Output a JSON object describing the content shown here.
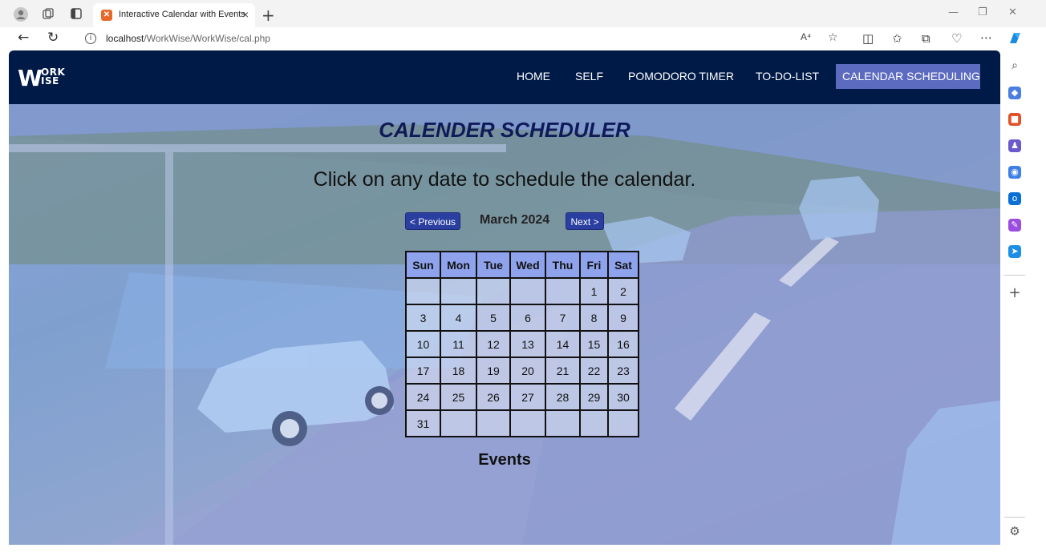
{
  "browser": {
    "tab_title": "Interactive Calendar with Events",
    "url_host": "localhost",
    "url_path": "/WorkWise/WorkWise/cal.php",
    "read_aloud_label": "A⁴"
  },
  "site": {
    "logo": {
      "w": "W",
      "top": "ORK",
      "bottom": "ISE"
    },
    "nav": [
      {
        "label": "HOME"
      },
      {
        "label": "SELF"
      },
      {
        "label": "POMODORO TIMER"
      },
      {
        "label": "TO-DO-LIST"
      },
      {
        "label": "CALENDAR SCHEDULING",
        "active": true
      }
    ]
  },
  "page": {
    "title": "CALENDER SCHEDULER",
    "instruction": "Click on any date to schedule the calendar.",
    "prev_button": "< Previous",
    "next_button": "Next >",
    "month_label": "March 2024",
    "events_title": "Events"
  },
  "calendar": {
    "weekdays": [
      "Sun",
      "Mon",
      "Tue",
      "Wed",
      "Thu",
      "Fri",
      "Sat"
    ],
    "weeks": [
      [
        "",
        "",
        "",
        "",
        "",
        "1",
        "2"
      ],
      [
        "3",
        "4",
        "5",
        "6",
        "7",
        "8",
        "9"
      ],
      [
        "10",
        "11",
        "12",
        "13",
        "14",
        "15",
        "16"
      ],
      [
        "17",
        "18",
        "19",
        "20",
        "21",
        "22",
        "23"
      ],
      [
        "24",
        "25",
        "26",
        "27",
        "28",
        "29",
        "30"
      ],
      [
        "31",
        "",
        "",
        "",
        "",
        "",
        ""
      ]
    ]
  },
  "colors": {
    "nav_bg": "#001a48",
    "nav_active": "#5c6bc0",
    "button_bg": "#2a3f9f",
    "header_cell": "#8ea3ec",
    "title_color": "#0f1a58"
  }
}
